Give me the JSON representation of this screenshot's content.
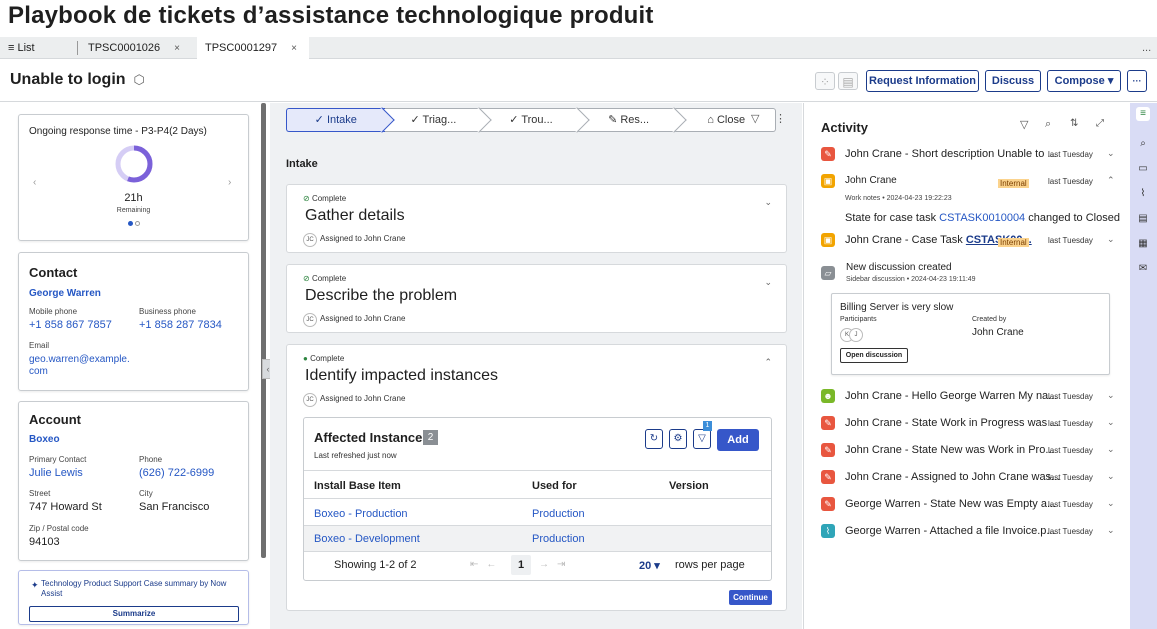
{
  "page_title": "Playbook de tickets d’assistance technologique produit",
  "tabs": {
    "list_label": "≡ List",
    "tab1": "TPSC0001026",
    "tab2": "TPSC0001297",
    "close_glyph": "×",
    "more": "..."
  },
  "record": {
    "title": "Unable to login",
    "request_info": "Request Information",
    "discuss": "Discuss",
    "compose": "Compose ▾",
    "more": "···"
  },
  "sla": {
    "title": "Ongoing response time - P3-P4(2 Days)",
    "remaining_value": "21h",
    "remaining_label": "Remaining",
    "progress_fraction": 0.56
  },
  "contact": {
    "heading": "Contact",
    "name": "George Warren",
    "mobile_label": "Mobile phone",
    "mobile": "+1 858 867 7857",
    "business_label": "Business phone",
    "business": "+1 858 287 7834",
    "email_label": "Email",
    "email_line1": "geo.warren@example.",
    "email_line2": "com"
  },
  "account": {
    "heading": "Account",
    "name": "Boxeo",
    "primary_label": "Primary Contact",
    "primary": "Julie Lewis",
    "phone_label": "Phone",
    "phone": "(626) 722-6999",
    "street_label": "Street",
    "street": "747 Howard St",
    "city_label": "City",
    "city": "San Francisco",
    "zip_label": "Zip / Postal code",
    "zip": "94103"
  },
  "now_assist": {
    "text": "Technology Product Support Case summary by Now Assist",
    "button": "Summarize"
  },
  "stepper": {
    "steps": [
      "Intake",
      "Triag...",
      "Trou...",
      "Res...",
      "Close"
    ]
  },
  "section_label": "Intake",
  "tasks": [
    {
      "status": "Complete",
      "title": "Gather details",
      "assign": "Assigned to John Crane",
      "initials": "JC"
    },
    {
      "status": "Complete",
      "title": "Describe the problem",
      "assign": "Assigned to John Crane",
      "initials": "JC"
    },
    {
      "status": "Complete",
      "title": "Identify impacted instances",
      "assign": "Assigned to John Crane",
      "initials": "JC"
    }
  ],
  "instances": {
    "title": "Affected Instances",
    "count": "2",
    "refreshed": "Last refreshed just now",
    "filter_badge": "1",
    "add": "Add",
    "columns": [
      "Install Base Item",
      "Used for",
      "Version"
    ],
    "rows": [
      {
        "item": "Boxeo - Production",
        "used_for": "Production",
        "version": ""
      },
      {
        "item": "Boxeo - Development",
        "used_for": "Production",
        "version": ""
      }
    ],
    "showing": "Showing 1-2 of 2",
    "page": "1",
    "per_page": "20 ▾",
    "rows_per_page": "rows per page",
    "continue": "Continue"
  },
  "activity": {
    "heading": "Activity",
    "items": [
      {
        "text": "John Crane - Short description Unable to ...",
        "time": "last Tuesday",
        "color": "#e8563f",
        "icon": "pencil-icon"
      },
      {
        "text": "John Crane",
        "time": "last Tuesday",
        "internal": "Internal",
        "color": "#f2a400",
        "icon": "lock-icon",
        "sub": "Work notes • 2024-04-23 19:22:23",
        "body_prefix": "State for case task ",
        "body_link": "CSTASK0010004",
        "body_suffix": " changed to Closed"
      },
      {
        "text_prefix": "John Crane - Case Task ",
        "text_link": "CSTASK00...",
        "time": "last Tuesday",
        "internal": "Internal",
        "color": "#f2a400",
        "icon": "lock-icon"
      },
      {
        "text": "New discussion created",
        "sub": "Sidebar discussion • 2024-04-23 19:11:49",
        "color": "#8a8f94",
        "icon": "chat-icon",
        "card_title": "Billing Server is very slow",
        "participants_label": "Participants",
        "created_label": "Created by",
        "created_by": "John Crane",
        "p1": "K",
        "p2": "J",
        "open_btn": "Open discussion"
      },
      {
        "text": "John Crane - Hello George Warren My na...",
        "time": "last Tuesday",
        "color": "#7ab829",
        "icon": "people-icon"
      },
      {
        "text": "John Crane - State Work in Progress was ...",
        "time": "last Tuesday",
        "color": "#e8563f",
        "icon": "pencil-icon"
      },
      {
        "text": "John Crane - State New was Work in Pro...",
        "time": "last Tuesday",
        "color": "#e8563f",
        "icon": "pencil-icon"
      },
      {
        "text": "John Crane - Assigned to John Crane was...",
        "time": "last Tuesday",
        "color": "#e8563f",
        "icon": "pencil-icon"
      },
      {
        "text": "George Warren - State New was Empty a...",
        "time": "last Tuesday",
        "color": "#e8563f",
        "icon": "pencil-icon"
      },
      {
        "text": "George Warren - Attached a file Invoice.p...",
        "time": "last Tuesday",
        "color": "#2fa5b8",
        "icon": "paperclip-icon"
      }
    ]
  },
  "colors": {
    "accent": "#1b3b8a",
    "link": "#2557c4",
    "sla_ring": "#7b61d9"
  }
}
